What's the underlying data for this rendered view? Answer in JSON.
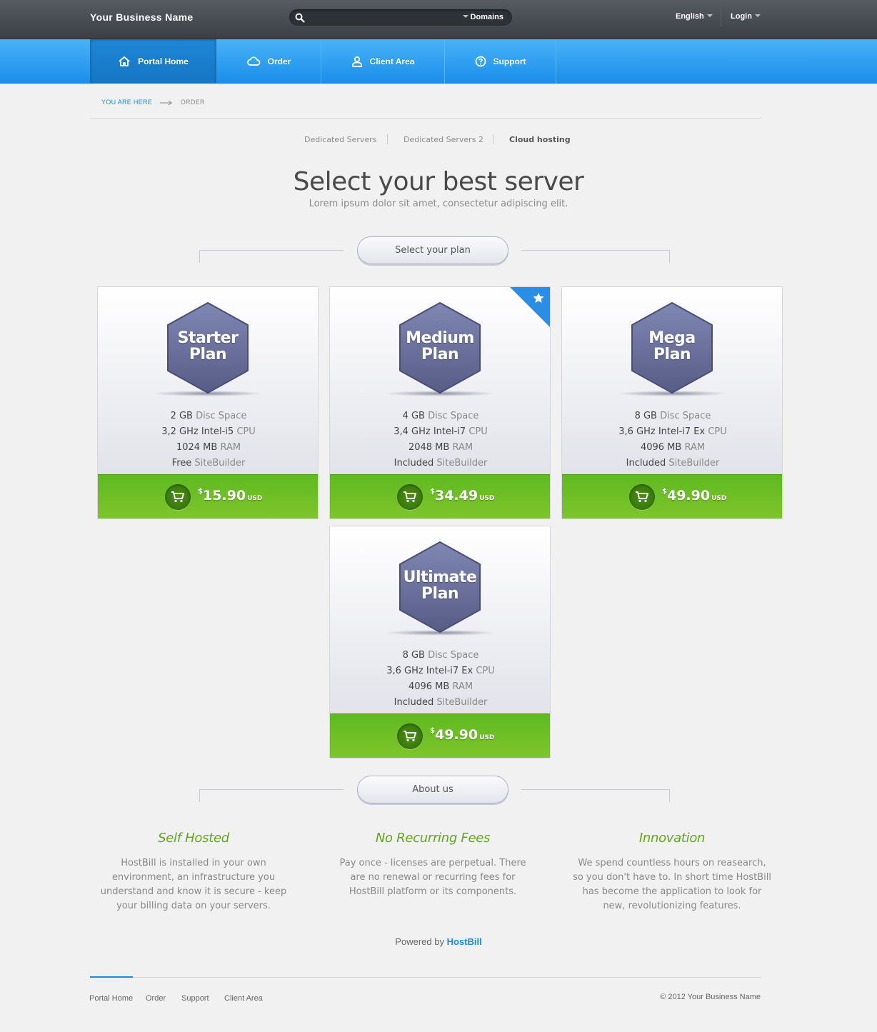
{
  "header": {
    "brand": "Your Business Name",
    "search_placeholder": "",
    "domains_label": "Domains",
    "language": "English",
    "login": "Login"
  },
  "nav": [
    {
      "label": "Portal Home",
      "icon": "home-icon",
      "active": true
    },
    {
      "label": "Order",
      "icon": "cloud-icon"
    },
    {
      "label": "Client Area",
      "icon": "user-icon"
    },
    {
      "label": "Support",
      "icon": "help-icon"
    }
  ],
  "breadcrumb": {
    "label": "YOU ARE HERE",
    "current": "ORDER"
  },
  "subtabs": [
    {
      "label": "Dedicated Servers"
    },
    {
      "label": "Dedicated Servers 2"
    },
    {
      "label": "Cloud hosting",
      "active": true
    }
  ],
  "page": {
    "title": "Select your best server",
    "subtitle": "Lorem ipsum dolor sit amet, consectetur adipiscing elit.",
    "plan_section": "Select your plan",
    "about_section": "About us"
  },
  "plans": [
    {
      "name1": "Starter",
      "name2": "Plan",
      "disk_val": "2 GB",
      "disk_lbl": "Disc Space",
      "cpu_val": "3,2 GHz Intel-i5",
      "cpu_lbl": "CPU",
      "ram_val": "1024 MB",
      "ram_lbl": "RAM",
      "sb_val": "Free",
      "sb_lbl": "SiteBuilder",
      "currency": "$",
      "price": "15.90",
      "unit": "USD"
    },
    {
      "name1": "Medium",
      "name2": "Plan",
      "disk_val": "4 GB",
      "disk_lbl": "Disc Space",
      "cpu_val": "3,4 GHz Intel-i7",
      "cpu_lbl": "CPU",
      "ram_val": "2048 MB",
      "ram_lbl": "RAM",
      "sb_val": "Included",
      "sb_lbl": "SiteBuilder",
      "currency": "$",
      "price": "34.49",
      "unit": "USD",
      "featured": true
    },
    {
      "name1": "Mega",
      "name2": "Plan",
      "disk_val": "8 GB",
      "disk_lbl": "Disc Space",
      "cpu_val": "3,6 GHz Intel-i7 Ex",
      "cpu_lbl": "CPU",
      "ram_val": "4096 MB",
      "ram_lbl": "RAM",
      "sb_val": "Included",
      "sb_lbl": "SiteBuilder",
      "currency": "$",
      "price": "49.90",
      "unit": "USD"
    },
    {
      "name1": "Ultimate",
      "name2": "Plan",
      "disk_val": "8 GB",
      "disk_lbl": "Disc Space",
      "cpu_val": "3,6 GHz Intel-i7 Ex",
      "cpu_lbl": "CPU",
      "ram_val": "4096 MB",
      "ram_lbl": "RAM",
      "sb_val": "Included",
      "sb_lbl": "SiteBuilder",
      "currency": "$",
      "price": "49.90",
      "unit": "USD"
    }
  ],
  "about": [
    {
      "title": "Self Hosted",
      "text": "HostBill is installed in your own environment, an infrastructure you understand and know it is secure - keep your billing data on your servers."
    },
    {
      "title": "No Recurring Fees",
      "text": "Pay once - licenses are perpetual. There are no renewal or recurring fees for HostBill platform or its components."
    },
    {
      "title": "Innovation",
      "text": "We spend countless hours on reasearch, so you don't have to. In short time HostBill has become the application to look for new, revolutionizing features."
    }
  ],
  "powered": {
    "prefix": "Powered by",
    "brand": "HostBill"
  },
  "footer": {
    "links": [
      "Portal Home",
      "Order",
      "Support",
      "Client Area"
    ],
    "copyright": "© 2012 Your Business Name"
  },
  "colors": {
    "accent": "#1b8be0",
    "green": "#6fbf25",
    "hex": "#6a6f99"
  }
}
